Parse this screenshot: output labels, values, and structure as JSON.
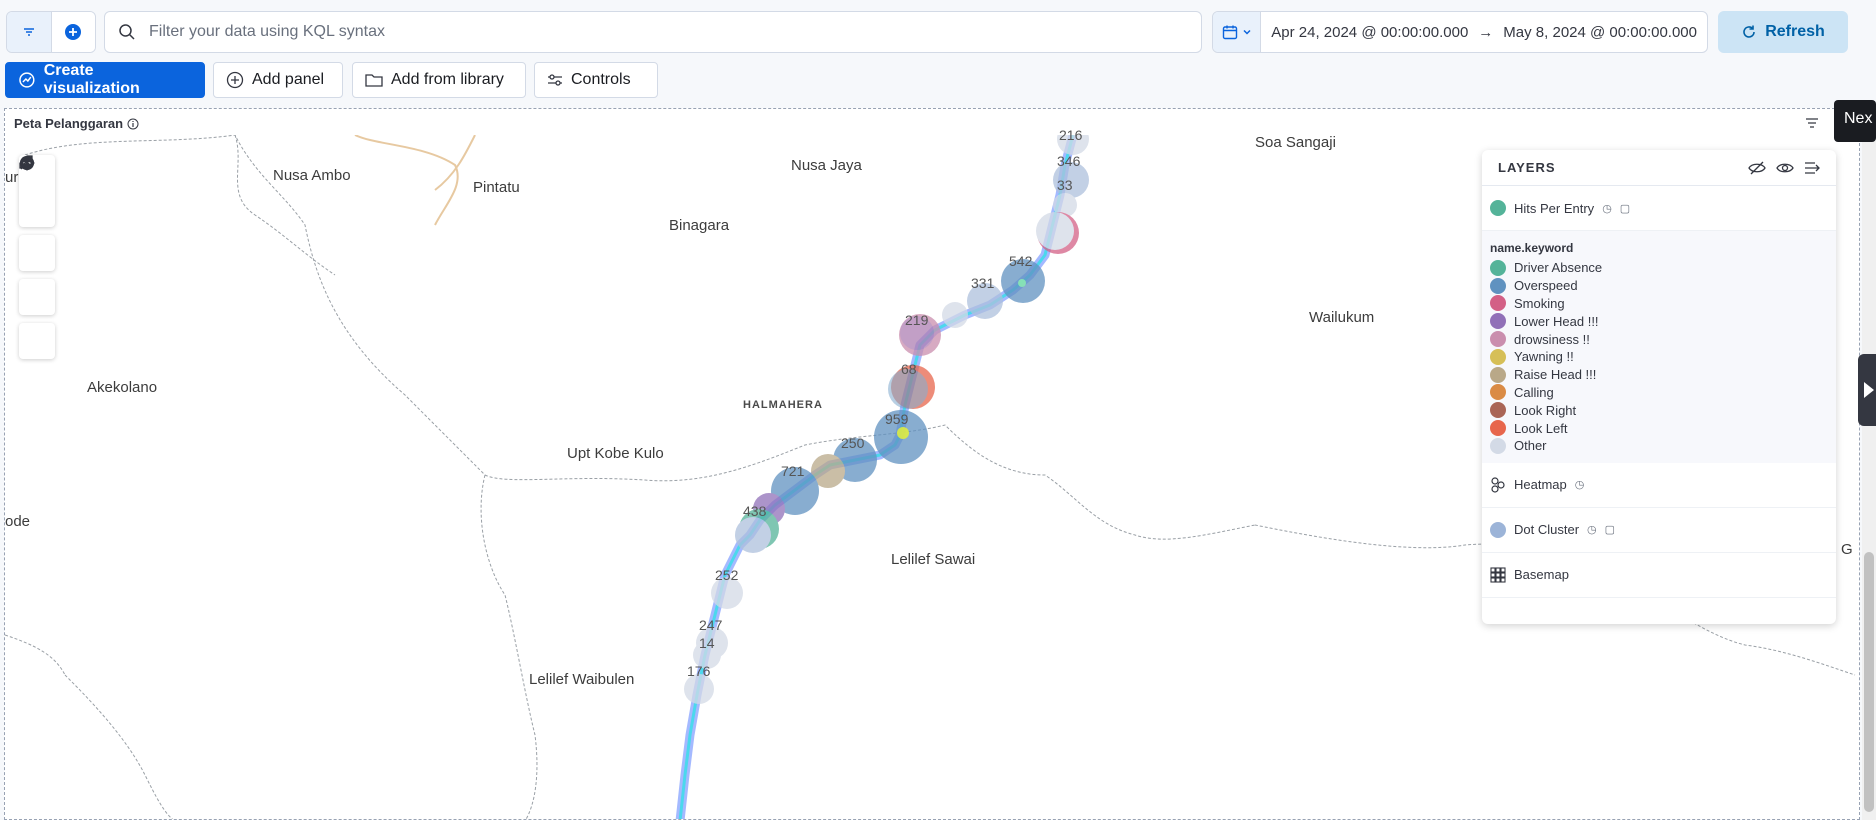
{
  "query_bar": {
    "search_placeholder": "Filter your data using KQL syntax",
    "date_start": "Apr 24, 2024 @ 00:00:00.000",
    "date_arrow": "→",
    "date_end": "May 8, 2024 @ 00:00:00.000",
    "refresh_label": "Refresh"
  },
  "toolbar": {
    "create_visualization": "Create visualization",
    "add_panel": "Add panel",
    "add_from_library": "Add from library",
    "controls": "Controls"
  },
  "panel": {
    "title": "Peta Pelanggaran"
  },
  "map": {
    "places": [
      "Soa Sangaji",
      "Nusa Ambo",
      "Nusa Jaya",
      "Pintatu",
      "Binagara",
      "Wailukum",
      "Akekolano",
      "HALMAHERA",
      "Upt Kobe Kulo",
      "Lelilef Sawai",
      "Lelilef Waibulen",
      "ode",
      "ur",
      "G"
    ],
    "cluster_labels": [
      "216",
      "346",
      "33",
      "542",
      "331",
      "219",
      "68",
      "959",
      "250",
      "721",
      "438",
      "252",
      "247",
      "14",
      "176"
    ]
  },
  "layers": {
    "heading": "LAYERS",
    "hits_layer": "Hits Per Entry",
    "legend_title": "name.keyword",
    "legend": [
      {
        "label": "Driver Absence",
        "color": "#54b399"
      },
      {
        "label": "Overspeed",
        "color": "#6092c0"
      },
      {
        "label": "Smoking",
        "color": "#d36086"
      },
      {
        "label": "Lower Head !!!",
        "color": "#9170b8"
      },
      {
        "label": "drowsiness !!",
        "color": "#ca8eae"
      },
      {
        "label": "Yawning !!",
        "color": "#d6bf57"
      },
      {
        "label": "Raise Head !!!",
        "color": "#b9a888"
      },
      {
        "label": "Calling",
        "color": "#da8b45"
      },
      {
        "label": "Look Right",
        "color": "#aa6556"
      },
      {
        "label": "Look Left",
        "color": "#e7664c"
      },
      {
        "label": "Other",
        "color": "#d3dae6"
      }
    ],
    "heatmap": "Heatmap",
    "dot_cluster": "Dot Cluster",
    "basemap": "Basemap"
  },
  "tooltip": {
    "next": "Nex"
  }
}
